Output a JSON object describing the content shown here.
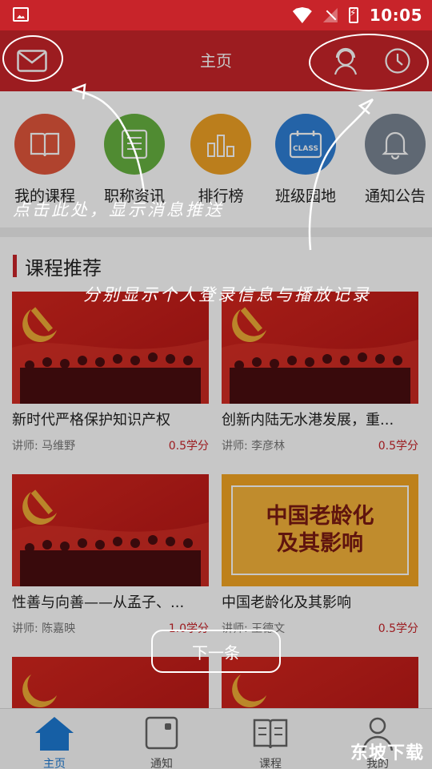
{
  "status_bar": {
    "time": "10:05"
  },
  "header": {
    "title": "主页"
  },
  "quick_actions": [
    {
      "label": "我的课程",
      "color": "#e2563c"
    },
    {
      "label": "职称资讯",
      "color": "#67b340"
    },
    {
      "label": "排行榜",
      "color": "#f0a224"
    },
    {
      "label": "班级园地",
      "color": "#2f7fd6"
    },
    {
      "label": "通知公告",
      "color": "#7a8694"
    }
  ],
  "quick_action_icons": {
    "class_badge": "CLASS"
  },
  "recommend": {
    "title": "课程推荐",
    "courses": [
      {
        "title": "新时代严格保护知识产权",
        "teacher": "讲师:  马维野",
        "credit": "0.5学分"
      },
      {
        "title": "创新内陆无水港发展，重...",
        "teacher": "讲师:  李彦林",
        "credit": "0.5学分"
      },
      {
        "title": "性善与向善——从孟子、...",
        "teacher": "讲师:  陈嘉映",
        "credit": "1.0学分"
      },
      {
        "title": "中国老龄化及其影响",
        "teacher": "讲师:  王德文",
        "credit": "0.5学分"
      }
    ],
    "thumb_text": [
      "中国老龄化",
      "及其影响"
    ]
  },
  "overlay": {
    "annotation_left": "点击此处，显示消息推送",
    "annotation_right": "分别显示个人登录信息与播放记录",
    "next_button": "下一条"
  },
  "tabbar": {
    "items": [
      "主页",
      "通知",
      "课程",
      "我的"
    ]
  },
  "watermark": "东坡下载",
  "colors": {
    "brand": "#c8242a",
    "tab_active": "#1d7ad4"
  }
}
